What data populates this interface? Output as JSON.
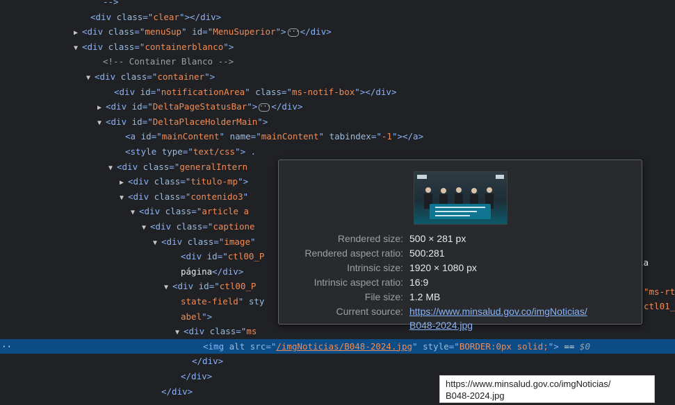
{
  "elements_panel": {
    "lines": [
      {
        "indent": 148,
        "arrow": "",
        "html": "<span class='tw'>--&gt;</span>"
      },
      {
        "indent": 130,
        "arrow": "",
        "html": "<span class='tw'>&lt;div </span><span class='an'>class</span><span class='tw'>=\"</span><span class='av'>clear</span><span class='tw'>\"&gt;&lt;/div&gt;</span>"
      },
      {
        "indent": 118,
        "arrow": "▶",
        "html": "<span class='tw'>&lt;div </span><span class='an'>class</span><span class='tw'>=\"</span><span class='av'>menuSup</span><span class='tw'>\" </span><span class='an'>id</span><span class='tw'>=\"</span><span class='av'>MenuSuperior</span><span class='tw'>\"&gt;</span><span class='ellipsis'>···</span><span class='tw'>&lt;/div&gt;</span>"
      },
      {
        "indent": 118,
        "arrow": "▼",
        "html": "<span class='tw'>&lt;div </span><span class='an'>class</span><span class='tw'>=\"</span><span class='av'>containerblanco</span><span class='tw'>\"&gt;</span>"
      },
      {
        "indent": 148,
        "arrow": "",
        "html": "<span class='cm'>&lt;!-- Container Blanco --&gt;</span>"
      },
      {
        "indent": 136,
        "arrow": "▼",
        "html": "<span class='tw'>&lt;div </span><span class='an'>class</span><span class='tw'>=\"</span><span class='av'>container</span><span class='tw'>\"&gt;</span>"
      },
      {
        "indent": 164,
        "arrow": "",
        "html": "<span class='tw'>&lt;div </span><span class='an'>id</span><span class='tw'>=\"</span><span class='av'>notificationArea</span><span class='tw'>\" </span><span class='an'>class</span><span class='tw'>=\"</span><span class='av'>ms-notif-box</span><span class='tw'>\"&gt;&lt;/div&gt;</span>"
      },
      {
        "indent": 152,
        "arrow": "▶",
        "html": "<span class='tw'>&lt;div </span><span class='an'>id</span><span class='tw'>=\"</span><span class='av'>DeltaPageStatusBar</span><span class='tw'>\"&gt;</span><span class='ellipsis'>···</span><span class='tw'>&lt;/div&gt;</span>"
      },
      {
        "indent": 152,
        "arrow": "▼",
        "html": "<span class='tw'>&lt;div </span><span class='an'>id</span><span class='tw'>=\"</span><span class='av'>DeltaPlaceHolderMain</span><span class='tw'>\"&gt;</span>"
      },
      {
        "indent": 180,
        "arrow": "",
        "html": "<span class='tw'>&lt;a </span><span class='an'>id</span><span class='tw'>=\"</span><span class='av'>mainContent</span><span class='tw'>\" </span><span class='an'>name</span><span class='tw'>=\"</span><span class='av'>mainContent</span><span class='tw'>\" </span><span class='an'>tabindex</span><span class='tw'>=\"</span><span class='av'>-1</span><span class='tw'>\"&gt;&lt;/a&gt;</span>"
      },
      {
        "indent": 180,
        "arrow": "",
        "html": "<span class='tw'>&lt;style </span><span class='an'>type</span><span class='tw'>=\"</span><span class='av'>text/css</span><span class='tw'>\"&gt; .</span>"
      },
      {
        "indent": 168,
        "arrow": "▼",
        "html": "<span class='tw'>&lt;div </span><span class='an'>class</span><span class='tw'>=\"</span><span class='av'>generalIntern</span>"
      },
      {
        "indent": 184,
        "arrow": "▶",
        "html": "<span class='tw'>&lt;div </span><span class='an'>class</span><span class='tw'>=\"</span><span class='av'>titulo-mp</span><span class='tw'>\"&gt;</span>"
      },
      {
        "indent": 184,
        "arrow": "▼",
        "html": "<span class='tw'>&lt;div </span><span class='an'>class</span><span class='tw'>=\"</span><span class='av'>contenido3</span><span class='tw'>\"</span>"
      },
      {
        "indent": 200,
        "arrow": "▼",
        "html": "<span class='tw'>&lt;div </span><span class='an'>class</span><span class='tw'>=\"</span><span class='av'>article a</span>"
      },
      {
        "indent": 216,
        "arrow": "▼",
        "html": "<span class='tw'>&lt;div </span><span class='an'>class</span><span class='tw'>=\"</span><span class='av'>captione</span>"
      },
      {
        "indent": 232,
        "arrow": "▼",
        "html": "<span class='tw'>&lt;div </span><span class='an'>class</span><span class='tw'>=\"</span><span class='av'>image</span><span class='tw'>\"</span>"
      },
      {
        "indent": 260,
        "arrow": "",
        "html": "<span class='tw'>&lt;div </span><span class='an'>id</span><span class='tw'>=\"</span><span class='av'>ctl00_P</span>"
      },
      {
        "indent": 260,
        "arrow": "",
        "html": "<span class='tx'>página</span><span class='tw'>&lt;/div&gt;</span>"
      },
      {
        "indent": 248,
        "arrow": "▼",
        "html": "<span class='tw'>&lt;div </span><span class='an'>id</span><span class='tw'>=\"</span><span class='av'>ctl00_P</span>"
      },
      {
        "indent": 260,
        "arrow": "",
        "html": "<span class='av'>state-field</span><span class='tw'>\" </span><span class='an'>sty</span>"
      },
      {
        "indent": 260,
        "arrow": "",
        "html": "<span class='av'>abel</span><span class='tw'>\"&gt;</span>"
      },
      {
        "indent": 264,
        "arrow": "▼",
        "html": "<span class='tw'>&lt;div </span><span class='an'>class</span><span class='tw'>=\"</span><span class='av'>ms</span>"
      },
      {
        "indent": 292,
        "arrow": "",
        "selected": true,
        "html": "<span class='tw'>&lt;img </span><span class='an'>alt src</span><span class='tw'>=\"</span><span class='link'>/imgNoticias/B048-2024.jpg</span><span class='tw'>\" </span><span class='an'>style</span><span class='tw'>=\"</span><span class='av'>BORDER:0px solid;</span><span class='tw'>\"&gt; </span><span class='tx'>== </span><span class='dollar'>$0</span>"
      },
      {
        "indent": 276,
        "arrow": "",
        "html": "<span class='tw'>&lt;/div&gt;</span>"
      },
      {
        "indent": 260,
        "arrow": "",
        "html": "<span class='tw'>&lt;/div&gt;</span>"
      },
      {
        "indent": 232,
        "arrow": "",
        "html": "<span class='tw'>&lt;/div&gt;</span>"
      }
    ],
    "right_fragments": [
      "la",
      "\"ms-rt",
      "ctl01_"
    ],
    "gutter_dots": "··"
  },
  "image_tooltip": {
    "rows": [
      {
        "key": "Rendered size:",
        "value": "500 × 281 px"
      },
      {
        "key": "Rendered aspect ratio:",
        "value": "500:281"
      },
      {
        "key": "Intrinsic size:",
        "value": "1920 × 1080 px"
      },
      {
        "key": "Intrinsic aspect ratio:",
        "value": "16:9"
      },
      {
        "key": "File size:",
        "value": "1.2 MB"
      }
    ],
    "current_source_label": "Current source:",
    "current_source_line1": "https://www.minsalud.gov.co/imgNoticias/",
    "current_source_line2": "B048-2024.jpg"
  },
  "url_tooltip": {
    "line1": "https://www.minsalud.gov.co/imgNoticias/",
    "line2": "B048-2024.jpg"
  }
}
